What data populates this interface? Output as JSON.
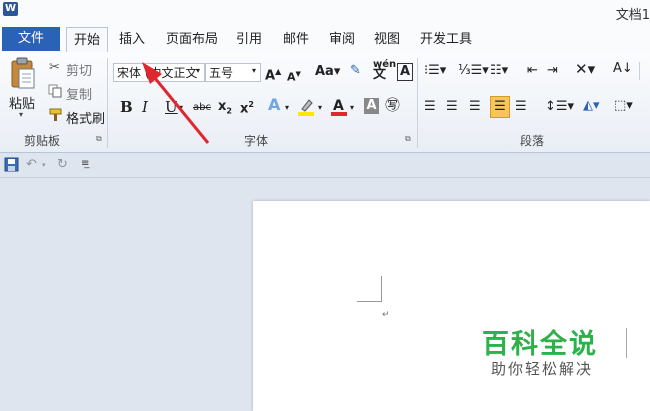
{
  "window": {
    "title": "文档1"
  },
  "tabs": [
    {
      "label": "文件"
    },
    {
      "label": "开始"
    },
    {
      "label": "插入"
    },
    {
      "label": "页面布局"
    },
    {
      "label": "引用"
    },
    {
      "label": "邮件"
    },
    {
      "label": "审阅"
    },
    {
      "label": "视图"
    },
    {
      "label": "开发工具"
    }
  ],
  "clipboard": {
    "paste": "粘贴",
    "cut": "剪切",
    "copy": "复制",
    "format_painter": "格式刷",
    "group_label": "剪贴板"
  },
  "font": {
    "font_name": "宋体 (中文正文",
    "font_size": "五号",
    "group_label": "字体"
  },
  "paragraph": {
    "group_label": "段落"
  },
  "watermark": {
    "main": "百科全说",
    "sub": "助你轻松解决"
  },
  "colors": {
    "file_tab": "#2a63b5",
    "arrow": "#e0262e",
    "watermark_green": "#2db14a",
    "highlight_yellow": "#ffe800",
    "font_red": "#e0262e"
  }
}
